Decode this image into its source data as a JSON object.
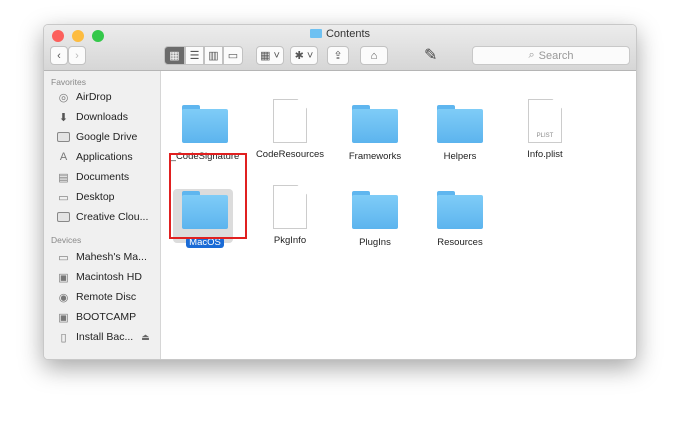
{
  "window": {
    "title": "Contents"
  },
  "toolbar": {
    "back": "‹",
    "forward": "›",
    "search_placeholder": "Search",
    "view_icon": "▦",
    "list": "☰",
    "columns": "▥",
    "cover": "▭",
    "arrange": "▦ ˅",
    "action": "✱ ˅",
    "share": "⇪",
    "tag": "⌂"
  },
  "sidebar": {
    "favorites_header": "Favorites",
    "favorites": [
      {
        "label": "AirDrop",
        "icon": "◎"
      },
      {
        "label": "Downloads",
        "icon": "⬇"
      },
      {
        "label": "Google Drive",
        "icon": "folder"
      },
      {
        "label": "Applications",
        "icon": "A"
      },
      {
        "label": "Documents",
        "icon": "▤"
      },
      {
        "label": "Desktop",
        "icon": "▭"
      },
      {
        "label": "Creative Clou...",
        "icon": "folder"
      }
    ],
    "devices_header": "Devices",
    "devices": [
      {
        "label": "Mahesh's Ma...",
        "icon": "▭"
      },
      {
        "label": "Macintosh HD",
        "icon": "▣"
      },
      {
        "label": "Remote Disc",
        "icon": "◉"
      },
      {
        "label": "BOOTCAMP",
        "icon": "▣"
      },
      {
        "label": "Install Bac...",
        "icon": "▯",
        "eject": "⏏"
      }
    ]
  },
  "files": [
    {
      "name": "_CodeSignature",
      "type": "folder"
    },
    {
      "name": "CodeResources",
      "type": "doc"
    },
    {
      "name": "Frameworks",
      "type": "folder"
    },
    {
      "name": "Helpers",
      "type": "folder"
    },
    {
      "name": "Info.plist",
      "type": "doc",
      "badge": "PLIST"
    },
    {
      "name": "MacOS",
      "type": "folder",
      "selected": true
    },
    {
      "name": "PkgInfo",
      "type": "doc"
    },
    {
      "name": "PlugIns",
      "type": "folder"
    },
    {
      "name": "Resources",
      "type": "folder"
    }
  ]
}
